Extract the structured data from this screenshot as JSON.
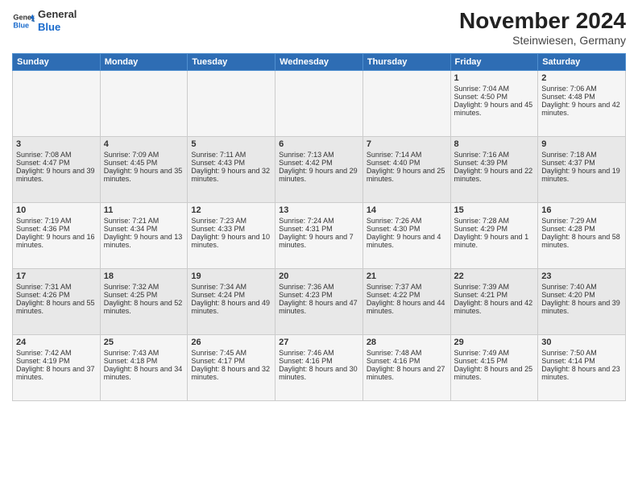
{
  "header": {
    "logo_general": "General",
    "logo_blue": "Blue",
    "month": "November 2024",
    "location": "Steinwiesen, Germany"
  },
  "days_of_week": [
    "Sunday",
    "Monday",
    "Tuesday",
    "Wednesday",
    "Thursday",
    "Friday",
    "Saturday"
  ],
  "weeks": [
    [
      {
        "day": "",
        "info": ""
      },
      {
        "day": "",
        "info": ""
      },
      {
        "day": "",
        "info": ""
      },
      {
        "day": "",
        "info": ""
      },
      {
        "day": "",
        "info": ""
      },
      {
        "day": "1",
        "info": "Sunrise: 7:04 AM\nSunset: 4:50 PM\nDaylight: 9 hours and 45 minutes."
      },
      {
        "day": "2",
        "info": "Sunrise: 7:06 AM\nSunset: 4:48 PM\nDaylight: 9 hours and 42 minutes."
      }
    ],
    [
      {
        "day": "3",
        "info": "Sunrise: 7:08 AM\nSunset: 4:47 PM\nDaylight: 9 hours and 39 minutes."
      },
      {
        "day": "4",
        "info": "Sunrise: 7:09 AM\nSunset: 4:45 PM\nDaylight: 9 hours and 35 minutes."
      },
      {
        "day": "5",
        "info": "Sunrise: 7:11 AM\nSunset: 4:43 PM\nDaylight: 9 hours and 32 minutes."
      },
      {
        "day": "6",
        "info": "Sunrise: 7:13 AM\nSunset: 4:42 PM\nDaylight: 9 hours and 29 minutes."
      },
      {
        "day": "7",
        "info": "Sunrise: 7:14 AM\nSunset: 4:40 PM\nDaylight: 9 hours and 25 minutes."
      },
      {
        "day": "8",
        "info": "Sunrise: 7:16 AM\nSunset: 4:39 PM\nDaylight: 9 hours and 22 minutes."
      },
      {
        "day": "9",
        "info": "Sunrise: 7:18 AM\nSunset: 4:37 PM\nDaylight: 9 hours and 19 minutes."
      }
    ],
    [
      {
        "day": "10",
        "info": "Sunrise: 7:19 AM\nSunset: 4:36 PM\nDaylight: 9 hours and 16 minutes."
      },
      {
        "day": "11",
        "info": "Sunrise: 7:21 AM\nSunset: 4:34 PM\nDaylight: 9 hours and 13 minutes."
      },
      {
        "day": "12",
        "info": "Sunrise: 7:23 AM\nSunset: 4:33 PM\nDaylight: 9 hours and 10 minutes."
      },
      {
        "day": "13",
        "info": "Sunrise: 7:24 AM\nSunset: 4:31 PM\nDaylight: 9 hours and 7 minutes."
      },
      {
        "day": "14",
        "info": "Sunrise: 7:26 AM\nSunset: 4:30 PM\nDaylight: 9 hours and 4 minutes."
      },
      {
        "day": "15",
        "info": "Sunrise: 7:28 AM\nSunset: 4:29 PM\nDaylight: 9 hours and 1 minute."
      },
      {
        "day": "16",
        "info": "Sunrise: 7:29 AM\nSunset: 4:28 PM\nDaylight: 8 hours and 58 minutes."
      }
    ],
    [
      {
        "day": "17",
        "info": "Sunrise: 7:31 AM\nSunset: 4:26 PM\nDaylight: 8 hours and 55 minutes."
      },
      {
        "day": "18",
        "info": "Sunrise: 7:32 AM\nSunset: 4:25 PM\nDaylight: 8 hours and 52 minutes."
      },
      {
        "day": "19",
        "info": "Sunrise: 7:34 AM\nSunset: 4:24 PM\nDaylight: 8 hours and 49 minutes."
      },
      {
        "day": "20",
        "info": "Sunrise: 7:36 AM\nSunset: 4:23 PM\nDaylight: 8 hours and 47 minutes."
      },
      {
        "day": "21",
        "info": "Sunrise: 7:37 AM\nSunset: 4:22 PM\nDaylight: 8 hours and 44 minutes."
      },
      {
        "day": "22",
        "info": "Sunrise: 7:39 AM\nSunset: 4:21 PM\nDaylight: 8 hours and 42 minutes."
      },
      {
        "day": "23",
        "info": "Sunrise: 7:40 AM\nSunset: 4:20 PM\nDaylight: 8 hours and 39 minutes."
      }
    ],
    [
      {
        "day": "24",
        "info": "Sunrise: 7:42 AM\nSunset: 4:19 PM\nDaylight: 8 hours and 37 minutes."
      },
      {
        "day": "25",
        "info": "Sunrise: 7:43 AM\nSunset: 4:18 PM\nDaylight: 8 hours and 34 minutes."
      },
      {
        "day": "26",
        "info": "Sunrise: 7:45 AM\nSunset: 4:17 PM\nDaylight: 8 hours and 32 minutes."
      },
      {
        "day": "27",
        "info": "Sunrise: 7:46 AM\nSunset: 4:16 PM\nDaylight: 8 hours and 30 minutes."
      },
      {
        "day": "28",
        "info": "Sunrise: 7:48 AM\nSunset: 4:16 PM\nDaylight: 8 hours and 27 minutes."
      },
      {
        "day": "29",
        "info": "Sunrise: 7:49 AM\nSunset: 4:15 PM\nDaylight: 8 hours and 25 minutes."
      },
      {
        "day": "30",
        "info": "Sunrise: 7:50 AM\nSunset: 4:14 PM\nDaylight: 8 hours and 23 minutes."
      }
    ]
  ]
}
